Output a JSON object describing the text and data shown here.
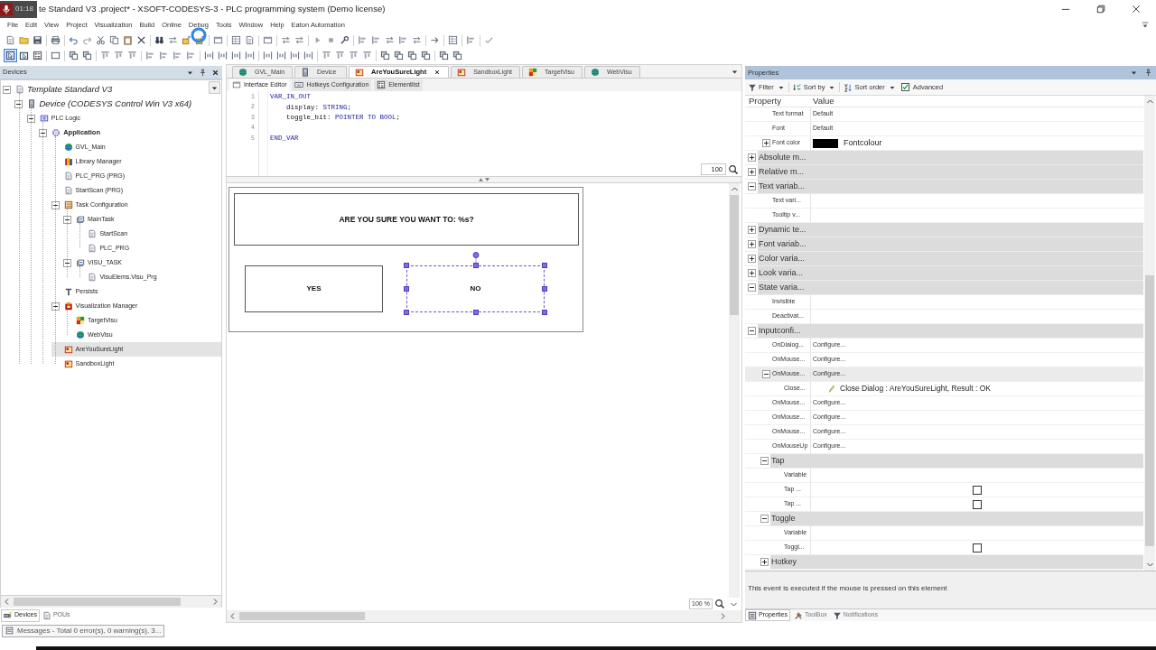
{
  "recording_badge": {
    "time": "01:18"
  },
  "window": {
    "title": "te Standard V3 .project* - XSOFT-CODESYS-3 - PLC programming system (Demo license)"
  },
  "menu": [
    "File",
    "Edit",
    "View",
    "Project",
    "Visualization",
    "Build",
    "Online",
    "Debug",
    "Tools",
    "Window",
    "Help",
    "Eaton Automation"
  ],
  "editor_modes": [
    {
      "selected": true
    },
    {
      "selected": false
    },
    {
      "selected": false
    }
  ],
  "devices_panel": {
    "title": "Devices",
    "tree": [
      {
        "label": "Template Standard V3",
        "kind": "project",
        "expanded": true,
        "selected": false,
        "children": [
          {
            "label": "Device (CODESYS Control Win V3 x64)",
            "kind": "device",
            "expanded": true,
            "selected": false,
            "children": [
              {
                "label": "PLC Logic",
                "kind": "plc",
                "expanded": true,
                "selected": false,
                "children": [
                  {
                    "label": "Application",
                    "kind": "application",
                    "expanded": true,
                    "selected": false,
                    "children": [
                      {
                        "label": "GVL_Main",
                        "kind": "gvl",
                        "selected": false
                      },
                      {
                        "label": "Library Manager",
                        "kind": "library",
                        "selected": false
                      },
                      {
                        "label": "PLC_PRG (PRG)",
                        "kind": "pou",
                        "selected": false
                      },
                      {
                        "label": "StartScan (PRG)",
                        "kind": "pou",
                        "selected": false
                      },
                      {
                        "label": "Task Configuration",
                        "kind": "task-config",
                        "expanded": true,
                        "selected": false,
                        "children": [
                          {
                            "label": "MainTask",
                            "kind": "task",
                            "expanded": true,
                            "selected": false,
                            "children": [
                              {
                                "label": "StartScan",
                                "kind": "call",
                                "selected": false
                              },
                              {
                                "label": "PLC_PRG",
                                "kind": "call",
                                "selected": false
                              }
                            ]
                          },
                          {
                            "label": "VISU_TASK",
                            "kind": "task",
                            "expanded": true,
                            "selected": false,
                            "children": [
                              {
                                "label": "VisuElems.Visu_Prg",
                                "kind": "call",
                                "selected": false
                              }
                            ]
                          }
                        ]
                      },
                      {
                        "label": "Persists",
                        "kind": "persist",
                        "selected": false
                      },
                      {
                        "label": "Visualization Manager",
                        "kind": "visu-manager",
                        "expanded": true,
                        "selected": false,
                        "children": [
                          {
                            "label": "TargetVisu",
                            "kind": "target-visu",
                            "selected": false
                          },
                          {
                            "label": "WebVisu",
                            "kind": "web-visu",
                            "selected": false
                          }
                        ]
                      },
                      {
                        "label": "AreYouSureLight",
                        "kind": "visu",
                        "selected": true
                      },
                      {
                        "label": "SandboxLight",
                        "kind": "visu",
                        "selected": false
                      }
                    ]
                  }
                ]
              }
            ]
          }
        ]
      }
    ],
    "tabs": [
      {
        "label": "Devices",
        "selected": true
      },
      {
        "label": "POUs",
        "selected": false
      }
    ]
  },
  "editor": {
    "tabs": [
      {
        "label": "GVL_Main",
        "kind": "gvl",
        "selected": false
      },
      {
        "label": "Device",
        "kind": "device",
        "selected": false
      },
      {
        "label": "AreYouSureLight",
        "kind": "visu",
        "selected": true
      },
      {
        "label": "SandboxLight",
        "kind": "visu",
        "selected": false
      },
      {
        "label": "TargetVisu",
        "kind": "target-visu",
        "selected": false
      },
      {
        "label": "WebVisu",
        "kind": "web-visu",
        "selected": false
      }
    ],
    "subtabs": [
      {
        "label": "Interface Editor",
        "selected": true
      },
      {
        "label": "Hotkeys Configuration",
        "selected": false
      },
      {
        "label": "Elementlist",
        "selected": false
      }
    ],
    "code": [
      {
        "number": "1",
        "tokens": [
          {
            "kind": "keyword",
            "text": "VAR_IN_OUT"
          }
        ]
      },
      {
        "number": "2",
        "tokens": [
          {
            "kind": "plain",
            "text": "    display: "
          },
          {
            "kind": "keyword",
            "text": "STRING"
          },
          {
            "kind": "plain",
            "text": ";"
          }
        ]
      },
      {
        "number": "3",
        "tokens": [
          {
            "kind": "plain",
            "text": "    toggle_bit: "
          },
          {
            "kind": "keyword",
            "text": "POINTER TO BOOL"
          },
          {
            "kind": "plain",
            "text": ";"
          }
        ]
      },
      {
        "number": "4"
      },
      {
        "number": "5",
        "tokens": [
          {
            "kind": "keyword",
            "text": "END_VAR"
          }
        ]
      }
    ],
    "code_zoom": "100",
    "canvas": {
      "elements": [
        {
          "kind": "label",
          "text": "ARE YOU SURE YOU WANT TO: %s?",
          "selected": false
        },
        {
          "kind": "button",
          "text": "YES",
          "selected": false
        },
        {
          "kind": "button",
          "text": "NO",
          "selected": true
        }
      ]
    },
    "canvas_zoom": "100 %"
  },
  "properties_panel": {
    "title": "Properties",
    "toolbar": [
      {
        "label": "Filter"
      },
      {
        "label": "Sort by"
      },
      {
        "label": "Sort order"
      }
    ],
    "advanced": {
      "label": "Advanced",
      "checked": true
    },
    "columns": [
      "Property",
      "Value"
    ],
    "rows": [
      {
        "kind": "property",
        "name": "Text format",
        "value": "Default",
        "selected": false
      },
      {
        "kind": "property",
        "name": "Font",
        "value": "Default",
        "selected": false
      },
      {
        "kind": "color",
        "name": "Font color",
        "expanded": false,
        "color": "#000000",
        "value": "Fontcolour",
        "selected": false
      },
      {
        "kind": "category",
        "name": "Absolute m...",
        "expanded": false,
        "selected": false
      },
      {
        "kind": "category",
        "name": "Relative m...",
        "expanded": false,
        "selected": false
      },
      {
        "kind": "category",
        "name": "Text variab...",
        "expanded": true,
        "selected": false,
        "children": [
          {
            "kind": "property",
            "name": "Text vari...",
            "selected": false
          },
          {
            "kind": "property",
            "name": "Tooltip v...",
            "selected": false
          }
        ]
      },
      {
        "kind": "category",
        "name": "Dynamic te...",
        "expanded": false,
        "selected": false
      },
      {
        "kind": "category",
        "name": "Font variab...",
        "expanded": false,
        "selected": false
      },
      {
        "kind": "category",
        "name": "Color varia...",
        "expanded": false,
        "selected": false
      },
      {
        "kind": "category",
        "name": "Look varia...",
        "expanded": false,
        "selected": false
      },
      {
        "kind": "category",
        "name": "State varia...",
        "expanded": true,
        "selected": false,
        "children": [
          {
            "kind": "property",
            "name": "Invisible",
            "selected": false
          },
          {
            "kind": "property",
            "name": "Deactivat...",
            "selected": false
          }
        ]
      },
      {
        "kind": "category",
        "name": "Inputconfi...",
        "expanded": true,
        "selected": false,
        "children": [
          {
            "kind": "property",
            "name": "OnDialog...",
            "value": "Configure...",
            "selected": false
          },
          {
            "kind": "property",
            "name": "OnMouse...",
            "value": "Configure...",
            "selected": false
          },
          {
            "kind": "property",
            "name": "OnMouse...",
            "value": "Configure...",
            "expanded": true,
            "selected": true,
            "children": [
              {
                "kind": "action",
                "name": "Close...",
                "value": "Close Dialog : AreYouSureLight, Result : OK",
                "selected": false
              }
            ]
          },
          {
            "kind": "property",
            "name": "OnMouse...",
            "value": "Configure...",
            "selected": false
          },
          {
            "kind": "property",
            "name": "OnMouse...",
            "value": "Configure...",
            "selected": false
          },
          {
            "kind": "property",
            "name": "OnMouse...",
            "value": "Configure...",
            "selected": false
          },
          {
            "kind": "property",
            "name": "OnMouseUp",
            "value": "Configure...",
            "selected": false
          },
          {
            "kind": "group",
            "name": "Tap",
            "expanded": true,
            "selected": false,
            "children": [
              {
                "kind": "property",
                "name": "Variable",
                "selected": false
              },
              {
                "kind": "checkbox",
                "name": "Tap ...",
                "checked": false,
                "selected": false
              },
              {
                "kind": "checkbox",
                "name": "Tap ...",
                "checked": false,
                "selected": false
              }
            ]
          },
          {
            "kind": "group",
            "name": "Toggle",
            "expanded": true,
            "selected": false,
            "children": [
              {
                "kind": "property",
                "name": "Variable",
                "selected": false
              },
              {
                "kind": "checkbox",
                "name": "Toggl...",
                "checked": false,
                "selected": false
              }
            ]
          },
          {
            "kind": "group",
            "name": "Hotkey",
            "expanded": false,
            "selected": false
          }
        ]
      }
    ],
    "description": "This event is executed if the mouse is pressed on this element",
    "tabs": [
      {
        "label": "Properties",
        "selected": true
      },
      {
        "label": "ToolBox",
        "selected": false
      },
      {
        "label": "Notifications",
        "selected": false
      }
    ]
  },
  "messages": {
    "label": "Messages - Total 0 error(s), 0 warning(s), 3..."
  }
}
